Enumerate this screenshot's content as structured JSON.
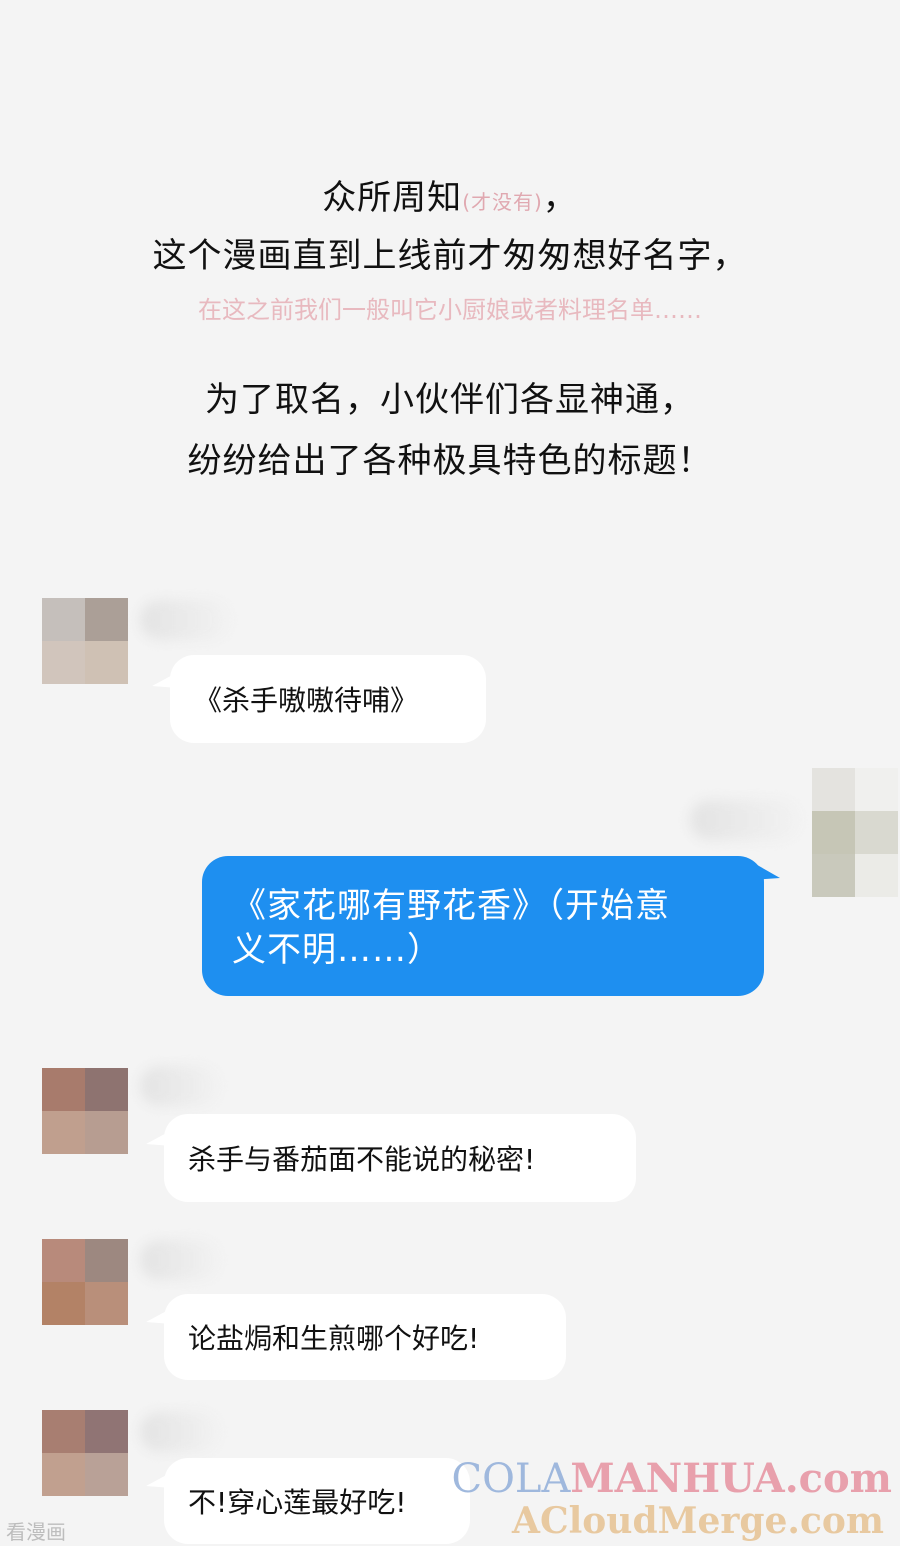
{
  "intro": {
    "line1_main": "众所周知",
    "line1_note": "(才没有)",
    "line1_end": "，",
    "line2": "这个漫画直到上线前才匆匆想好名字，",
    "line3": "在这之前我们一般叫它小厨娘或者料理名单……",
    "line4": "为了取名，小伙伴们各显神通，",
    "line5": "纷纷给出了各种极具特色的标题！"
  },
  "messages": [
    {
      "side": "left",
      "text": "《杀手嗷嗷待哺》"
    },
    {
      "side": "right",
      "text_line1": "《家花哪有野花香》（开始意",
      "text_line2": "义不明……）"
    },
    {
      "side": "left",
      "text": "杀手与番茄面不能说的秘密!"
    },
    {
      "side": "left",
      "text": "论盐焗和生煎哪个好吃!"
    },
    {
      "side": "left",
      "text": "不!穿心莲最好吃!"
    }
  ],
  "colors": {
    "background": "#f4f4f4",
    "bubble_white": "#ffffff",
    "bubble_blue": "#1e8ff0",
    "pink_note": "#e8b9bf"
  },
  "watermarks": {
    "cola_part1": "COLA",
    "cola_part2": "MANHUA.com",
    "acloud": "ACloudMerge.com",
    "kanmanhua": "看漫画"
  }
}
